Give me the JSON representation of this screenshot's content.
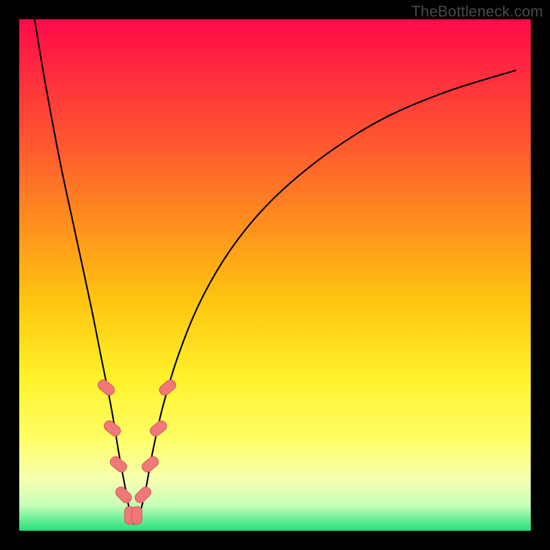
{
  "watermark": "TheBottleneck.com",
  "colors": {
    "frame": "#000000",
    "gradient_top": "#ff0a4a",
    "gradient_bottom": "#22e07a",
    "curve": "#000000",
    "marker_fill": "#f07878",
    "marker_stroke": "#d35a5a"
  },
  "chart_data": {
    "type": "line",
    "title": "",
    "xlabel": "",
    "ylabel": "",
    "xlim": [
      0,
      100
    ],
    "ylim": [
      0,
      100
    ],
    "grid": false,
    "note": "x and y are normalized; y≈100 at top of plot, y≈0 at bottom. Curve is a V-shaped bottleneck trough with minimum near x≈22.",
    "series": [
      {
        "name": "bottleneck-curve",
        "x": [
          3,
          5,
          8,
          11,
          14,
          16,
          18,
          19.5,
          21,
          22,
          23,
          24.5,
          26,
          28,
          31,
          35,
          40,
          46,
          53,
          62,
          72,
          84,
          97
        ],
        "y": [
          100,
          88,
          72,
          58,
          44,
          34,
          24,
          15,
          7,
          2,
          2,
          7,
          15,
          24,
          34,
          44,
          53,
          61,
          68,
          75,
          81,
          86,
          90
        ]
      }
    ],
    "markers": [
      {
        "x": 17.0,
        "y": 28,
        "rot": -50
      },
      {
        "x": 18.2,
        "y": 20,
        "rot": -50
      },
      {
        "x": 19.4,
        "y": 13,
        "rot": -50
      },
      {
        "x": 20.4,
        "y": 7,
        "rot": -45
      },
      {
        "x": 21.6,
        "y": 3,
        "rot": 0
      },
      {
        "x": 23.0,
        "y": 3,
        "rot": 0
      },
      {
        "x": 24.2,
        "y": 7,
        "rot": 45
      },
      {
        "x": 25.6,
        "y": 13,
        "rot": 50
      },
      {
        "x": 27.2,
        "y": 20,
        "rot": 50
      },
      {
        "x": 29.0,
        "y": 28,
        "rot": 50
      }
    ]
  }
}
